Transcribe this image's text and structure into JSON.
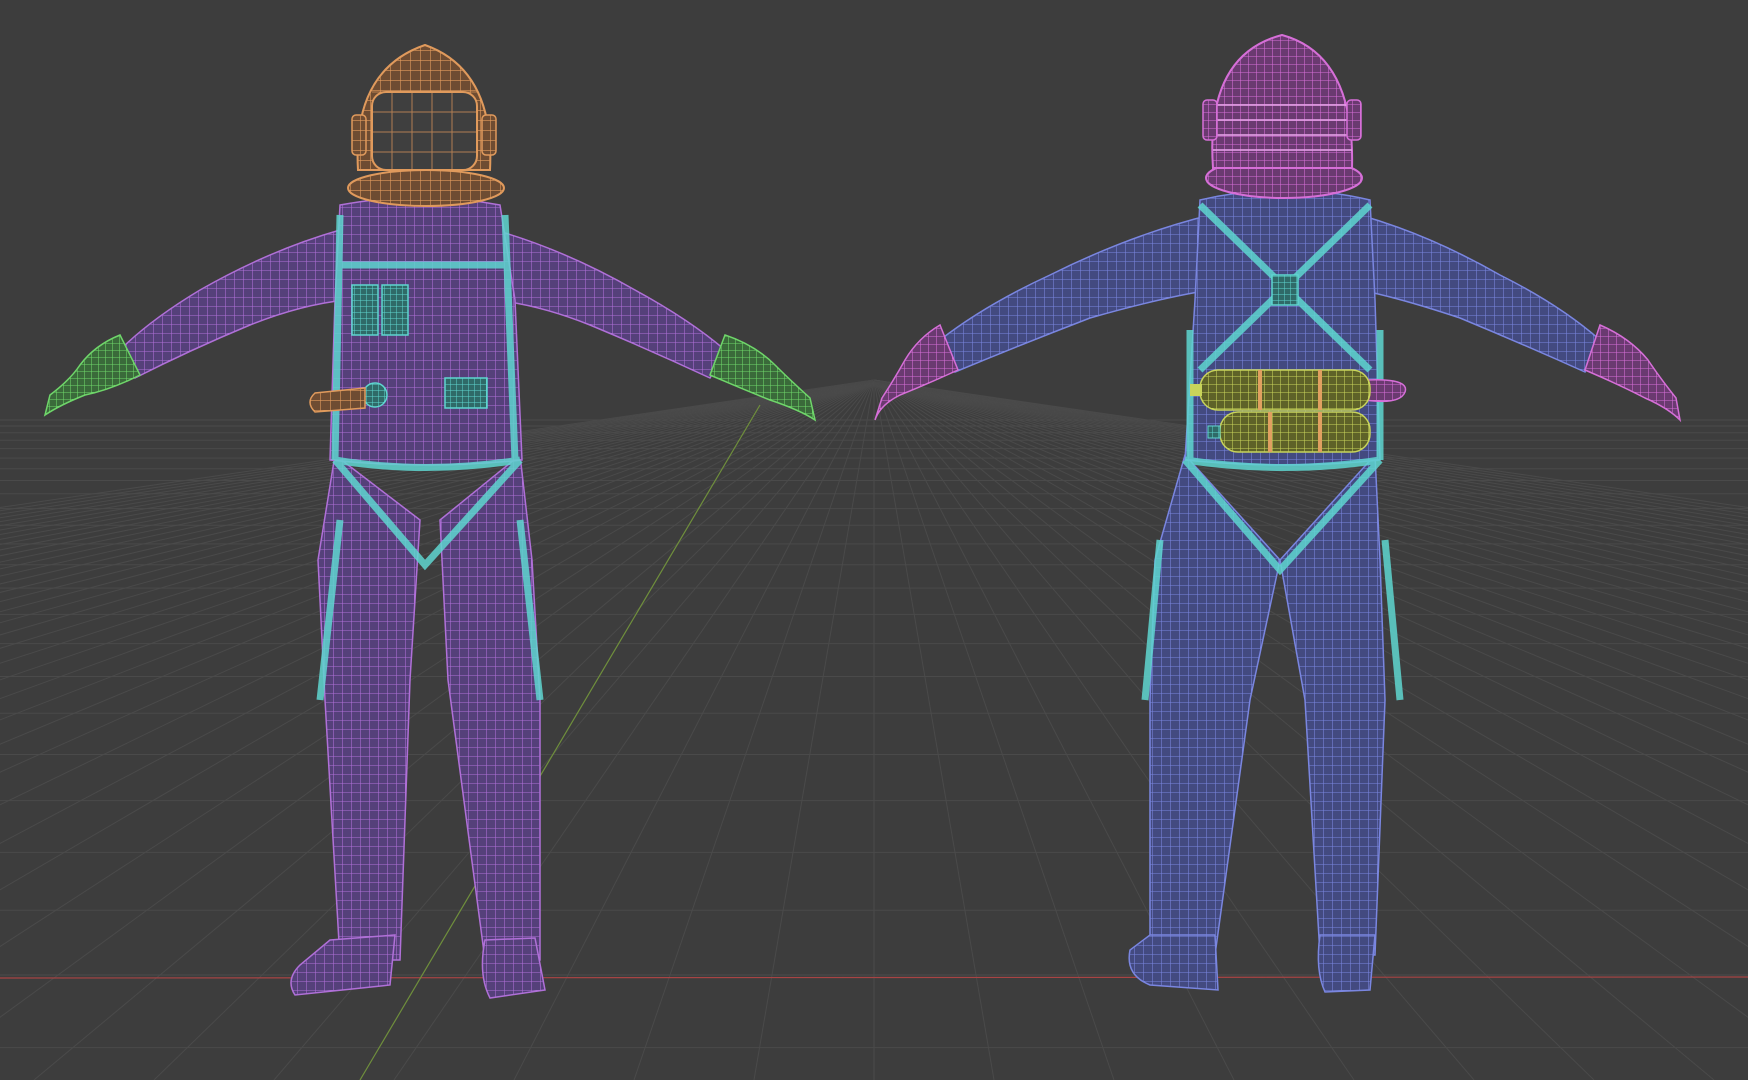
{
  "viewport": {
    "background": "#3d3d3d",
    "grid_color": "#4a4a4a",
    "x_axis_color": "#a84444",
    "y_axis_color": "#6f8f3c"
  },
  "figures": [
    {
      "view": "front",
      "colors": {
        "suit": "#b070d8",
        "harness": "#5fd6d0",
        "helmet": "#e09a5c",
        "gloves": "#6fd66a",
        "boots": "#b070d8",
        "hose": "#e09a5c"
      }
    },
    {
      "view": "back",
      "colors": {
        "suit": "#7a86e0",
        "harness": "#5fd6d0",
        "helmet": "#d66fd8",
        "gloves": "#d66fd8",
        "boots": "#7a86e0",
        "tanks": "#c8d45a"
      }
    }
  ]
}
